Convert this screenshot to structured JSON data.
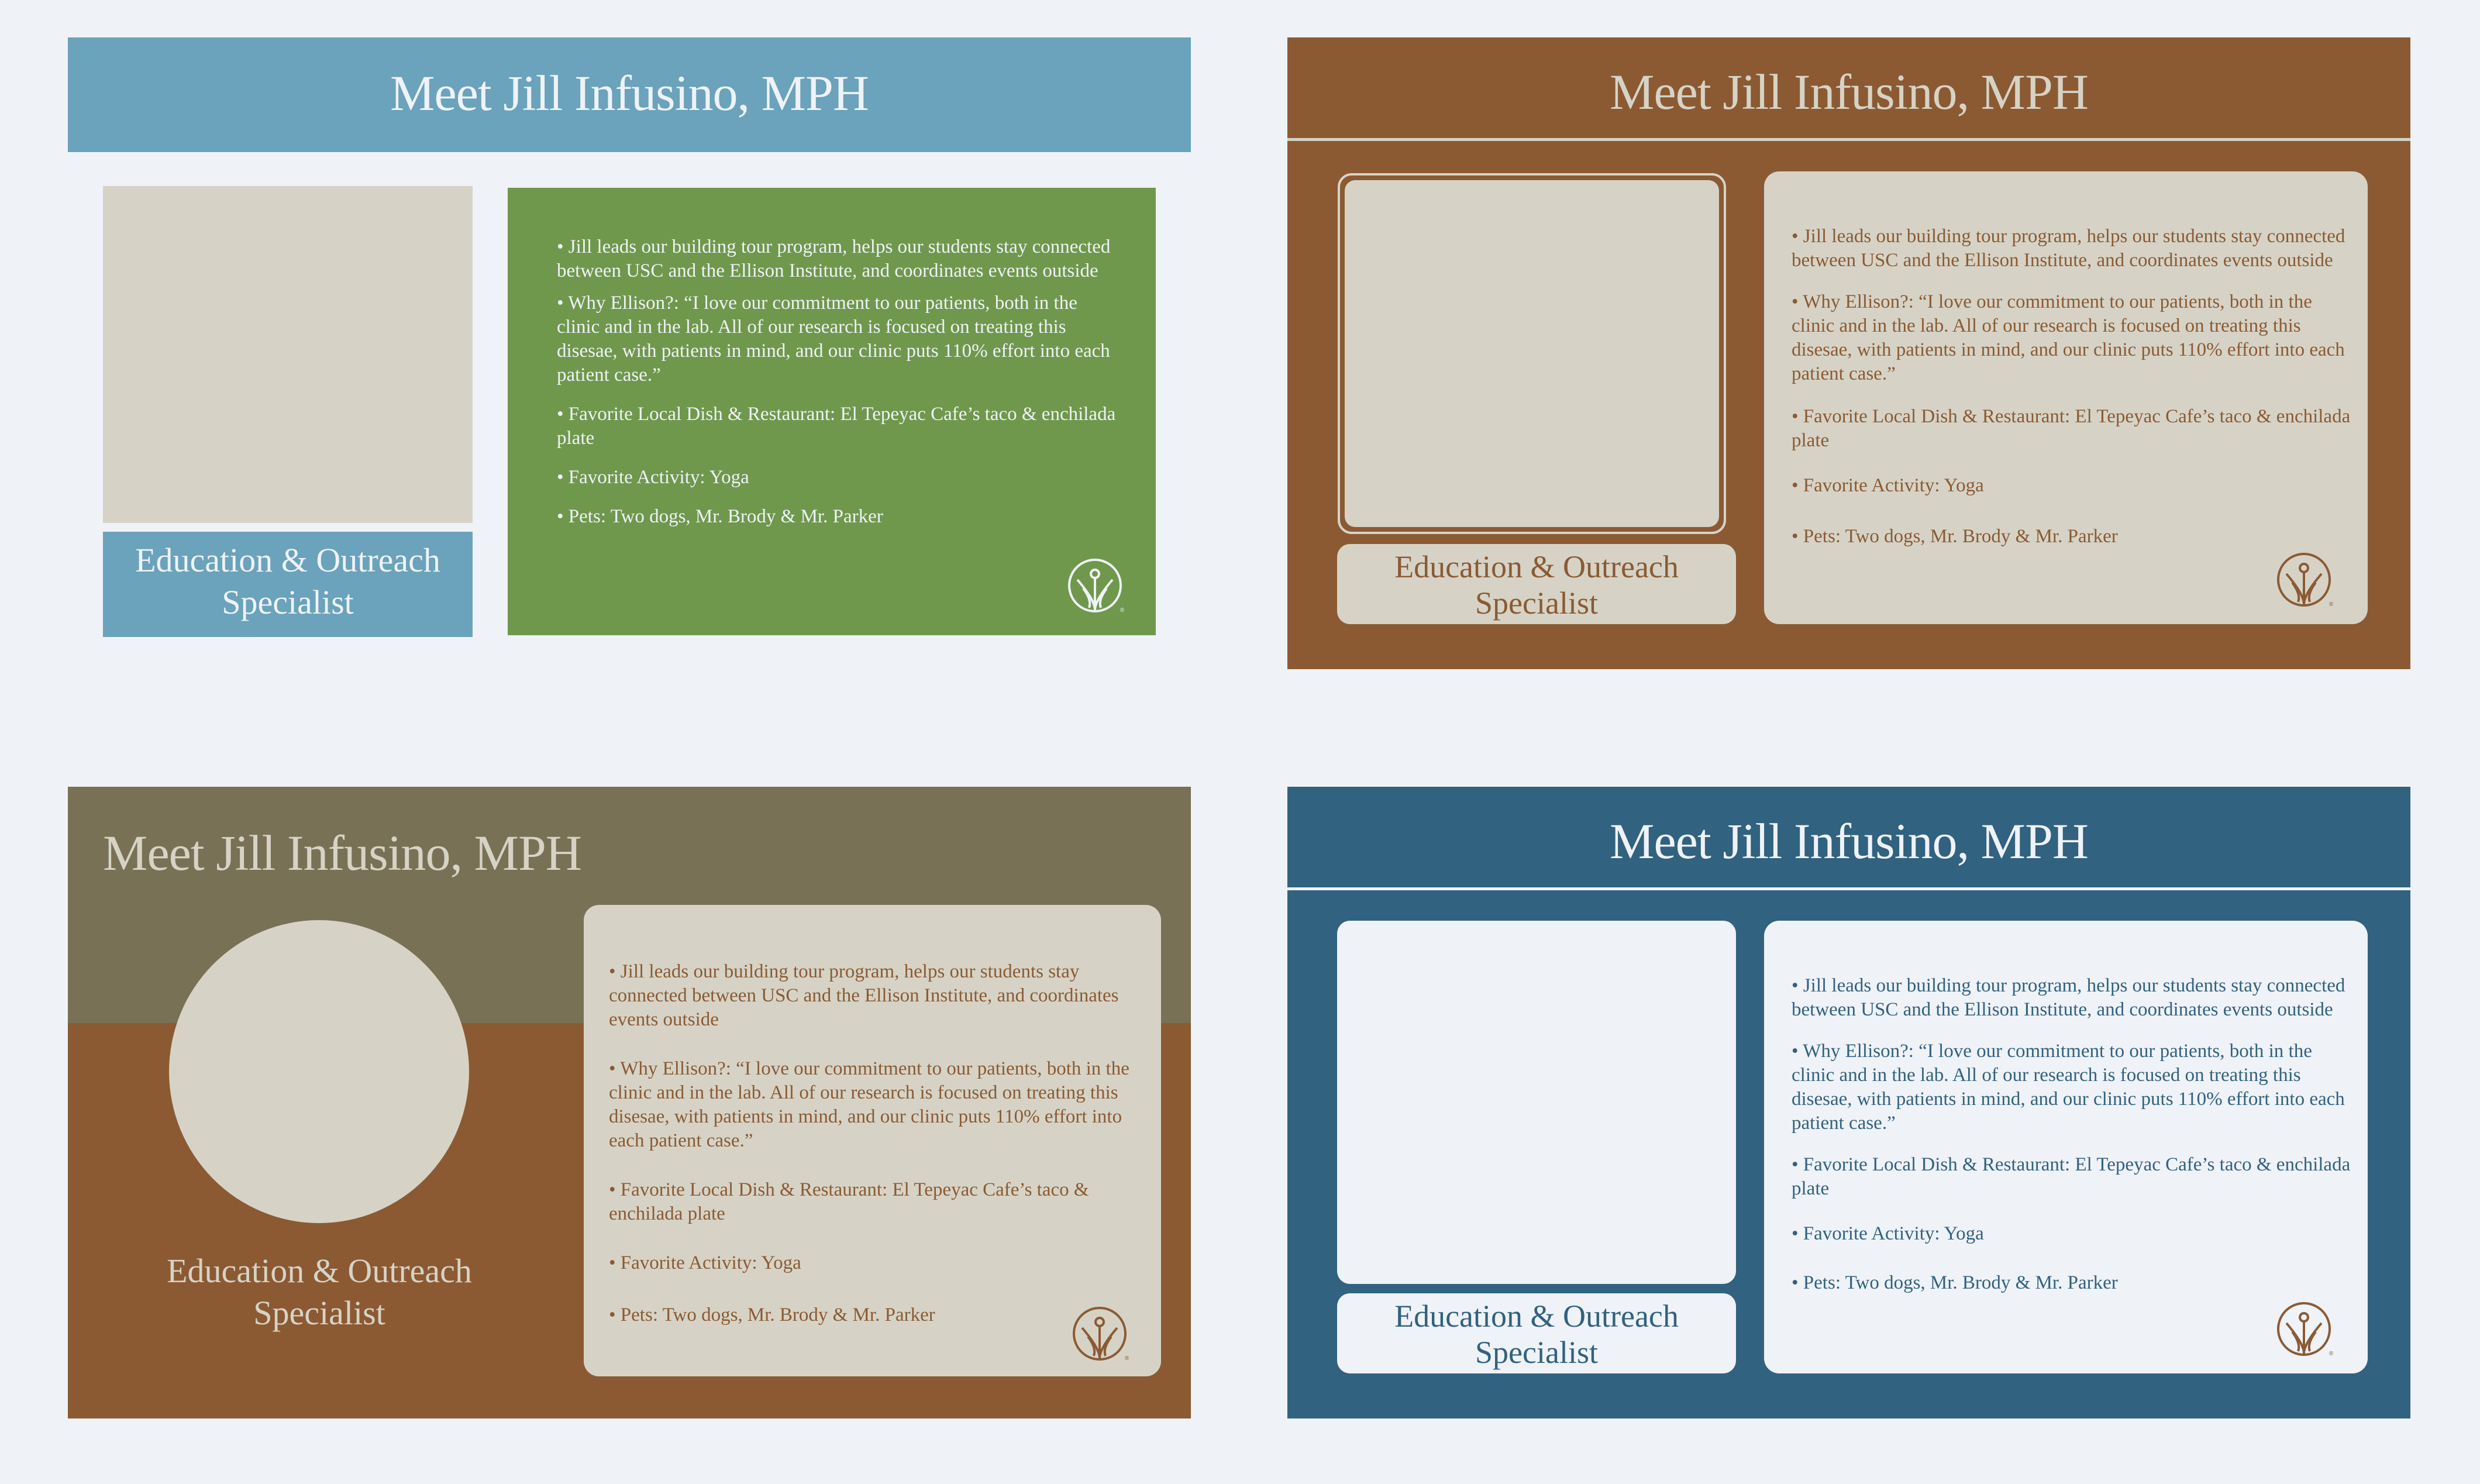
{
  "colors": {
    "page_background": "#eff2f7",
    "steel_blue": "#6aa3bb",
    "green": "#6f984c",
    "brown": "#8b5a33",
    "taupe": "#d6d3c6",
    "olive": "#797155",
    "navy": "#31627f",
    "white_panel": "#eff2f7"
  },
  "slides": [
    {
      "variant": "blue-green",
      "title": "Meet Jill Infusino, MPH",
      "role": [
        "Education & Outreach",
        "Specialist"
      ],
      "bullets": [
        "• Jill leads our building tour program, helps our students stay connected between USC and the Ellison Institute, and coordinates events outside",
        "• Why Ellison?: “I love our commitment to our patients, both in the clinic and in the lab. All of our research is focused on treating this disesae, with patients in mind, and our clinic puts 110% effort into each patient case.”",
        "• Favorite Local Dish & Restaurant: El Tepeyac Cafe’s taco & enchilada plate",
        "• Favorite Activity: Yoga",
        "• Pets: Two dogs, Mr. Brody & Mr. Parker"
      ],
      "logo_icon": "ellison-logo-icon"
    },
    {
      "variant": "brown-taupe",
      "title": "Meet Jill Infusino, MPH",
      "role": [
        "Education & Outreach",
        "Specialist"
      ],
      "bullets": [
        "• Jill leads our building tour program, helps our students stay connected between USC and the Ellison Institute, and coordinates events outside",
        "• Why Ellison?: “I love our commitment to our patients, both in the clinic and in the lab. All of our research is focused on treating this disesae, with patients in mind, and our clinic puts 110% effort into each patient case.”",
        "• Favorite Local Dish & Restaurant: El Tepeyac Cafe’s taco & enchilada plate",
        "• Favorite Activity: Yoga",
        "• Pets: Two dogs, Mr. Brody & Mr. Parker"
      ],
      "logo_icon": "ellison-logo-icon"
    },
    {
      "variant": "olive-brown",
      "title": "Meet Jill Infusino, MPH",
      "role": [
        "Education & Outreach",
        "Specialist"
      ],
      "bullets": [
        "• Jill leads our building tour program, helps our students stay connected between USC and the Ellison Institute, and coordinates events outside",
        "• Why Ellison?: “I love our commitment to our patients, both in the clinic and in the lab. All of our research is focused on treating this disesae, with patients in mind, and our clinic puts 110% effort into each patient case.”",
        "• Favorite Local Dish & Restaurant: El Tepeyac Cafe’s taco & enchilada plate",
        "• Favorite Activity: Yoga",
        "• Pets: Two dogs, Mr. Brody & Mr. Parker"
      ],
      "logo_icon": "ellison-logo-icon"
    },
    {
      "variant": "navy-white",
      "title": "Meet Jill Infusino, MPH",
      "role": [
        "Education & Outreach",
        "Specialist"
      ],
      "bullets": [
        "• Jill leads our building tour program, helps our students stay connected between USC and the Ellison Institute, and coordinates events outside",
        "• Why Ellison?: “I love our commitment to our patients, both in the clinic and in the lab. All of our research is focused on treating this disesae, with patients in mind, and our clinic puts 110% effort into each patient case.”",
        "• Favorite Local Dish & Restaurant: El Tepeyac Cafe’s taco & enchilada plate",
        "• Favorite Activity: Yoga",
        "• Pets: Two dogs, Mr. Brody & Mr. Parker"
      ],
      "logo_icon": "ellison-logo-icon"
    }
  ]
}
